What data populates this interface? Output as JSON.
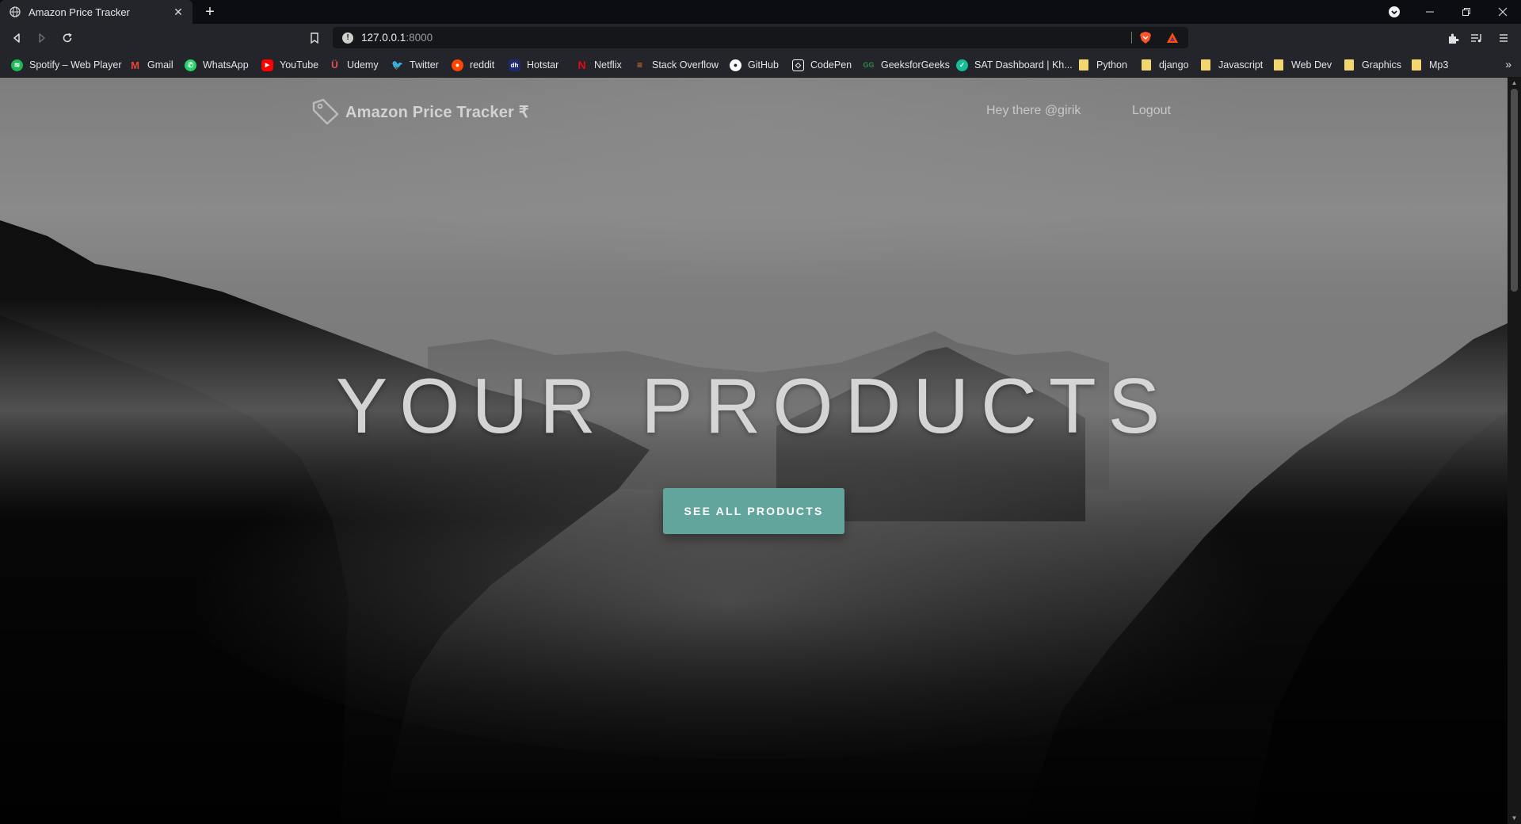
{
  "browser": {
    "tab_title": "Amazon Price Tracker",
    "url_host": "127.0.0.1",
    "url_port": ":8000",
    "window_controls": [
      "minimize-icon",
      "restore-icon",
      "close-icon"
    ]
  },
  "bookmarks": [
    {
      "label": "Spotify – Web Player",
      "icon": "spotify-icon",
      "color": "#1db954"
    },
    {
      "label": "Gmail",
      "icon": "gmail-icon",
      "color": "#ea4335"
    },
    {
      "label": "WhatsApp",
      "icon": "whatsapp-icon",
      "color": "#25d366"
    },
    {
      "label": "YouTube",
      "icon": "youtube-icon",
      "color": "#ff0000"
    },
    {
      "label": "Udemy",
      "icon": "udemy-icon",
      "color": "#ec5252"
    },
    {
      "label": "Twitter",
      "icon": "twitter-icon",
      "color": "#1da1f2"
    },
    {
      "label": "reddit",
      "icon": "reddit-icon",
      "color": "#ff4500"
    },
    {
      "label": "Hotstar",
      "icon": "hotstar-icon",
      "color": "#1f2a6b"
    },
    {
      "label": "Netflix",
      "icon": "netflix-icon",
      "color": "#e50914"
    },
    {
      "label": "Stack Overflow",
      "icon": "stackoverflow-icon",
      "color": "#f48024"
    },
    {
      "label": "GitHub",
      "icon": "github-icon",
      "color": "#ffffff"
    },
    {
      "label": "CodePen",
      "icon": "codepen-icon",
      "color": "#ffffff"
    },
    {
      "label": "GeeksforGeeks",
      "icon": "geeksforgeeks-icon",
      "color": "#2f8d46"
    },
    {
      "label": "SAT Dashboard | Kh...",
      "icon": "khan-academy-icon",
      "color": "#14bf96"
    },
    {
      "label": "Python",
      "icon": "folder-icon",
      "color": "#f3d670"
    },
    {
      "label": "django",
      "icon": "folder-icon",
      "color": "#f3d670"
    },
    {
      "label": "Javascript",
      "icon": "folder-icon",
      "color": "#f3d670"
    },
    {
      "label": "Web Dev",
      "icon": "folder-icon",
      "color": "#f3d670"
    },
    {
      "label": "Graphics",
      "icon": "folder-icon",
      "color": "#f3d670"
    },
    {
      "label": "Mp3",
      "icon": "folder-icon",
      "color": "#f3d670"
    }
  ],
  "site": {
    "brand": "Amazon Price Tracker ₹",
    "greeting": "Hey there @girik",
    "logout": "Logout",
    "headline": "YOUR PRODUCTS",
    "cta": "SEE ALL PRODUCTS",
    "accent_color": "#62a59c"
  }
}
